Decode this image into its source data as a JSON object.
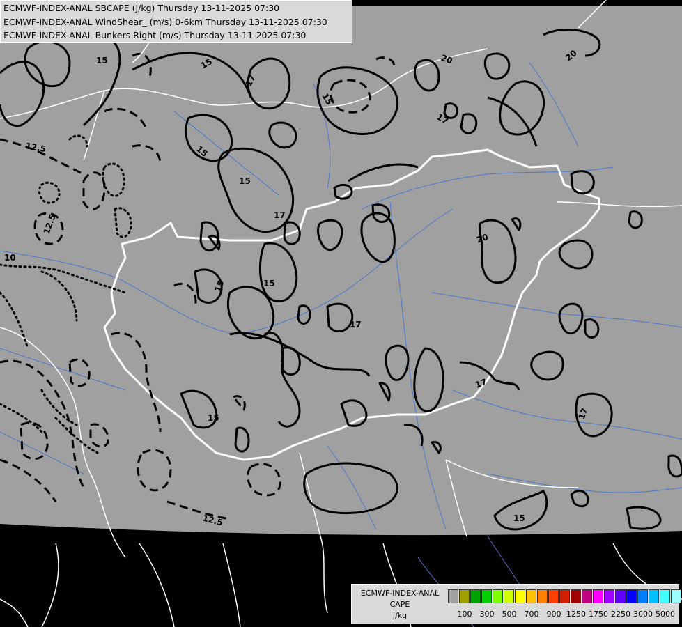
{
  "header": {
    "lines": [
      "ECMWF-INDEX-ANAL SBCAPE (J/kg) Thursday 13-11-2025 07:30",
      "ECMWF-INDEX-ANAL WindShear_ (m/s) 0-6km Thursday 13-11-2025 07:30",
      "ECMWF-INDEX-ANAL Bunkers Right (m/s) Thursday 13-11-2025 07:30"
    ]
  },
  "legend": {
    "title_lines": [
      "ECMWF-INDEX-ANAL",
      "CAPE",
      "J/kg"
    ],
    "colors": [
      "#a0a0a0",
      "#a0a000",
      "#00a000",
      "#00d000",
      "#80ff00",
      "#d0ff00",
      "#ffff00",
      "#ffc000",
      "#ff8000",
      "#ff4000",
      "#d02000",
      "#a00000",
      "#c00080",
      "#ff00ff",
      "#a000ff",
      "#6000ff",
      "#0000ff",
      "#0080ff",
      "#00c0ff",
      "#40ffff",
      "#a0ffff",
      "#ffffff"
    ],
    "ticks": [
      "100",
      "300",
      "500",
      "700",
      "900",
      "1250",
      "1750",
      "2250",
      "3000",
      "5000"
    ]
  },
  "map": {
    "background_color": "#a0a0a0",
    "border_color": "#ffffff",
    "river_color": "#4a78c8",
    "contour_labels": [
      "15",
      "17",
      "20",
      "15",
      "15",
      "15",
      "17",
      "17",
      "20",
      "15",
      "12.5",
      "12.5",
      "10",
      "17",
      "20",
      "15",
      "15",
      "12.5",
      "15",
      "17",
      "17",
      "15"
    ]
  }
}
